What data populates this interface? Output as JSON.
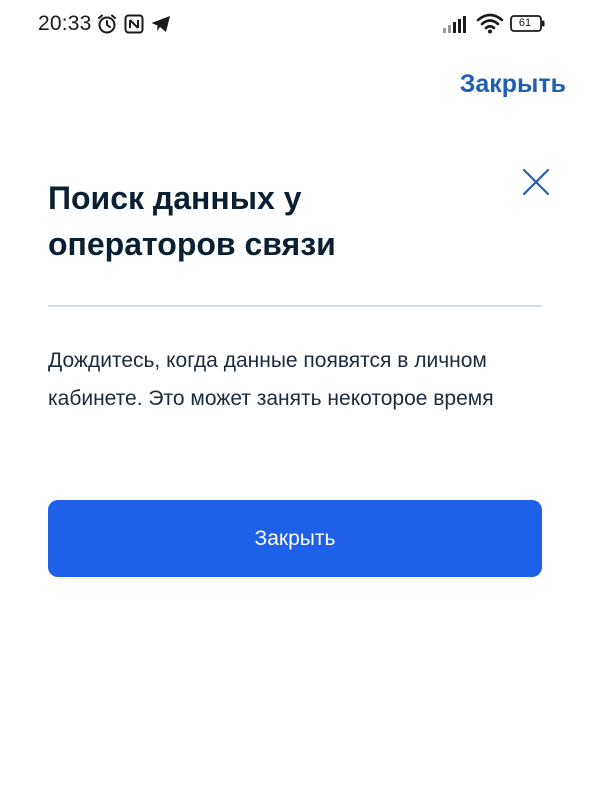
{
  "status_bar": {
    "time": "20:33",
    "battery": "61",
    "icons": [
      "alarm-icon",
      "nfc-icon",
      "telegram-icon",
      "signal-icon",
      "wifi-icon",
      "battery-icon"
    ]
  },
  "header": {
    "close_link_label": "Закрыть"
  },
  "modal": {
    "title": "Поиск данных у операторов связи",
    "message": "Дождитесь, когда данные появятся в личном кабинете. Это может занять некоторое время",
    "close_button_label": "Закрыть"
  },
  "colors": {
    "link": "#2060b0",
    "primary": "#1e61e8",
    "title": "#0b1f33",
    "divider": "#d3dde9",
    "close_icon": "#2a5cb0"
  }
}
